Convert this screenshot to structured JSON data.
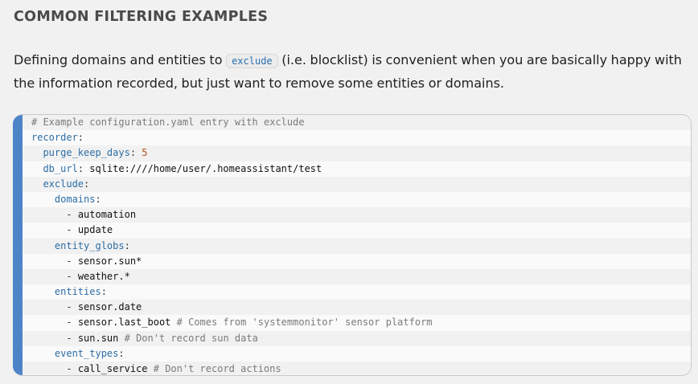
{
  "heading": "COMMON FILTERING EXAMPLES",
  "paragraph": {
    "before": "Defining domains and entities to ",
    "code": "exclude",
    "after": " (i.e. blocklist) is convenient when you are basically happy with the information recorded, but just want to remove some entities or domains."
  },
  "code_block": {
    "comment": "# Example configuration.yaml entry with exclude",
    "recorder_key": "recorder",
    "purge_key": "purge_keep_days",
    "purge_value": "5",
    "db_url_key": "db_url",
    "db_url_value": "sqlite:////home/user/.homeassistant/test",
    "exclude_key": "exclude",
    "domains_key": "domains",
    "domains": [
      "automation",
      "update"
    ],
    "entity_globs_key": "entity_globs",
    "entity_globs": [
      "sensor.sun*",
      "weather.*"
    ],
    "entities_key": "entities",
    "entity_1": "sensor.date",
    "entity_2": "sensor.last_boot",
    "entity_2_comment": "# Comes from 'systemmonitor' sensor platform",
    "entity_3": "sun.sun",
    "entity_3_comment": "# Don't record sun data",
    "event_types_key": "event_types",
    "event_1": "call_service",
    "event_1_comment": "# Don't record actions"
  },
  "colors": {
    "accent_bar": "#4d83c7",
    "yaml_key": "#2d6ea6",
    "number": "#b3541e",
    "comment": "#7a7a7a"
  }
}
